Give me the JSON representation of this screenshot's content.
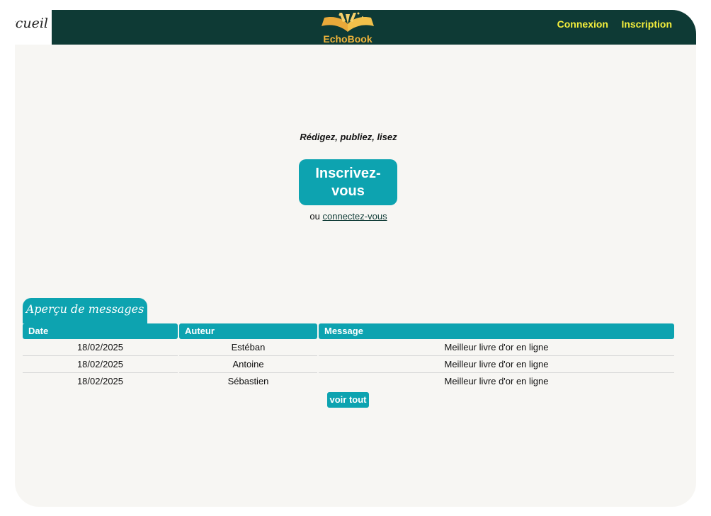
{
  "header": {
    "home_label": "Accueil",
    "logo_text": "EchoBook",
    "nav": [
      "Connexion",
      "Inscription"
    ]
  },
  "hero": {
    "tagline": "Rédigez, publiez, lisez",
    "cta_label": "Inscrivez-vous",
    "or_text": "ou",
    "login_link": "connectez-vous"
  },
  "preview": {
    "title": "Aperçu de messages",
    "columns": [
      "Date",
      "Auteur",
      "Message"
    ],
    "rows": [
      {
        "date": "18/02/2025",
        "author": "Estéban",
        "message": "Meilleur livre d'or en ligne"
      },
      {
        "date": "18/02/2025",
        "author": "Antoine",
        "message": "Meilleur livre d'or en ligne"
      },
      {
        "date": "18/02/2025",
        "author": "Sébastien",
        "message": "Meilleur livre d'or en ligne"
      }
    ],
    "see_all": "voir tout"
  },
  "colors": {
    "header_bg": "#0e3a35",
    "accent": "#0da3b0",
    "nav_text": "#f4ee3c",
    "page_bg": "#f7f6f3"
  }
}
